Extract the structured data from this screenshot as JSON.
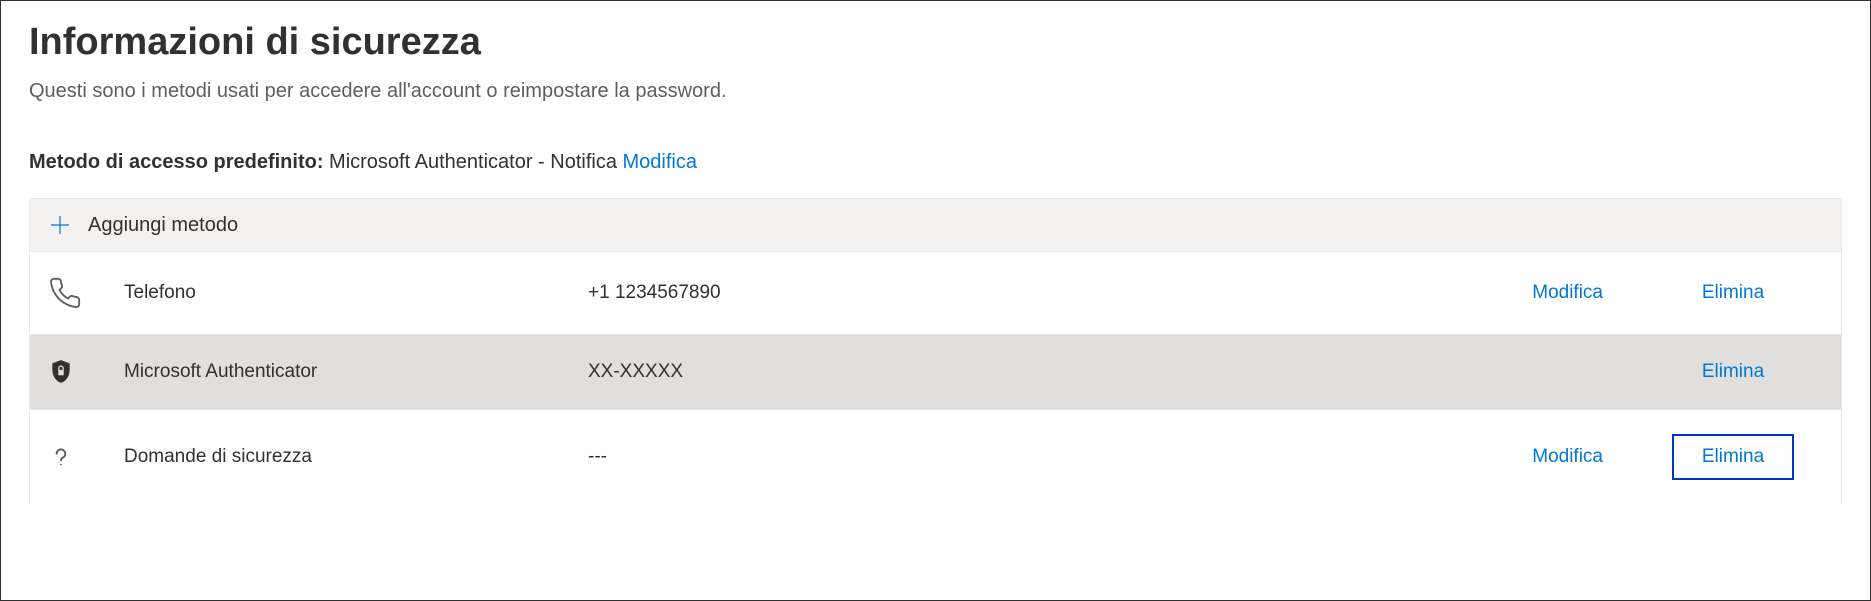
{
  "header": {
    "title": "Informazioni di sicurezza",
    "subtitle": "Questi sono i metodi usati per accedere all'account o reimpostare la password."
  },
  "defaultMethod": {
    "label": "Metodo di accesso predefinito:",
    "value": "Microsoft Authenticator - Notifica",
    "modifyLabel": "Modifica"
  },
  "addMethod": {
    "label": "Aggiungi metodo"
  },
  "methods": [
    {
      "icon": "phone",
      "name": "Telefono",
      "value": "+1 1234567890",
      "modify": "Modifica",
      "delete": "Elimina"
    },
    {
      "icon": "authenticator",
      "name": "Microsoft Authenticator",
      "value": "XX-XXXXX",
      "modify": "",
      "delete": "Elimina"
    },
    {
      "icon": "question",
      "name": "Domande di sicurezza",
      "value": "---",
      "modify": "Modifica",
      "delete": "Elimina"
    }
  ]
}
